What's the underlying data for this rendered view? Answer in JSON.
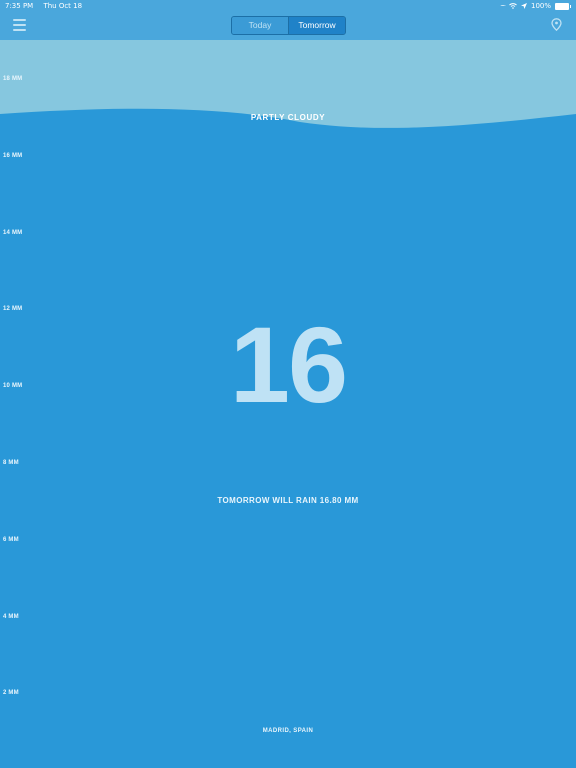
{
  "status_bar": {
    "time": "7:35 PM",
    "date": "Thu Oct 18",
    "battery": "100%",
    "icons": [
      "signal-dots-icon",
      "wifi-icon",
      "location-arrow-icon",
      "battery-icon"
    ]
  },
  "nav": {
    "menu_icon": "hamburger-menu-icon",
    "tabs": [
      {
        "label": "Today",
        "selected": false
      },
      {
        "label": "Tomorrow",
        "selected": true
      }
    ],
    "location_icon": "location-pin-icon"
  },
  "scale": {
    "ticks": [
      "18 MM",
      "16 MM",
      "14 MM",
      "12 MM",
      "10 MM",
      "8 MM",
      "6 MM",
      "4 MM",
      "2 MM"
    ]
  },
  "forecast": {
    "condition": "PARTLY CLOUDY",
    "rain_value": "16",
    "summary": "TOMORROW WILL RAIN 16.80 MM",
    "location": "MADRID, SPAIN",
    "rain_level_mm": 16.8
  },
  "colors": {
    "water": "#2998d8",
    "sky": "#86c7df",
    "header": "#4aa7dc",
    "digits": "#bfe2f5"
  }
}
